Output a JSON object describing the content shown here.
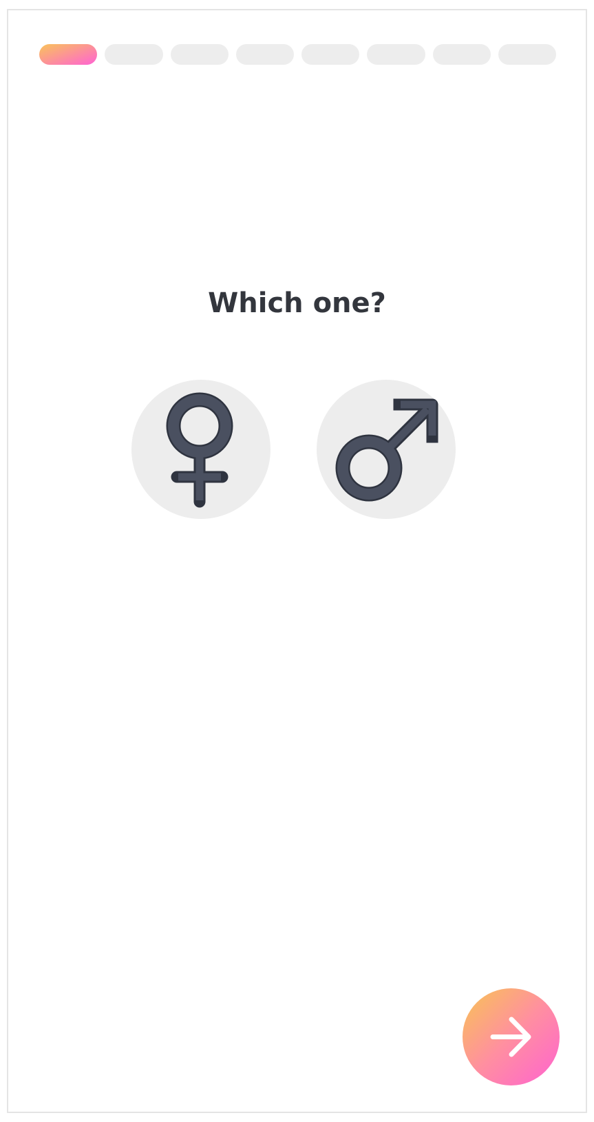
{
  "onboarding": {
    "progress": {
      "total_steps": 8,
      "current_step": 1
    },
    "question": "Which one?",
    "options": [
      {
        "icon": "female-symbol-icon"
      },
      {
        "icon": "male-symbol-icon"
      }
    ],
    "next_button": {
      "icon": "arrow-right-icon"
    }
  },
  "colors": {
    "accent_gradient_start": "#f9c35a",
    "accent_gradient_end": "#ff63d3",
    "inactive": "#ededed",
    "icon_fill": "#4a5060",
    "icon_outline": "#2f3440",
    "title": "#33363d"
  }
}
